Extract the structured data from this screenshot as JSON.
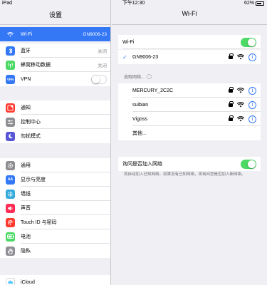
{
  "status_bar": {
    "device": "iPad",
    "time": "下午12:30",
    "battery": "62%"
  },
  "left": {
    "title": "设置",
    "group1": [
      {
        "label": "Wi-Fi",
        "value": "GN9006-23",
        "icon": "wifi-icon",
        "color": "#3478f6",
        "selected": true
      },
      {
        "label": "蓝牙",
        "value": "关闭",
        "icon": "bluetooth-icon",
        "color": "#3478f6"
      },
      {
        "label": "蜂窝移动数据",
        "value": "关闭",
        "icon": "antenna-icon",
        "color": "#4cd964"
      },
      {
        "label": "VPN",
        "icon": "vpn-icon",
        "icon_text": "VPN",
        "color": "#3478f6",
        "toggle": "off"
      }
    ],
    "group2": [
      {
        "label": "通知",
        "icon": "notification-icon",
        "color": "#ff3b30"
      },
      {
        "label": "控制中心",
        "icon": "control-center-icon",
        "color": "#8e8e93"
      },
      {
        "label": "勿扰模式",
        "icon": "moon-icon",
        "color": "#5856d6"
      }
    ],
    "group3": [
      {
        "label": "通用",
        "icon": "gear-icon",
        "color": "#8e8e93"
      },
      {
        "label": "显示与亮度",
        "icon": "display-icon",
        "icon_text": "AA",
        "color": "#3478f6"
      },
      {
        "label": "墙纸",
        "icon": "wallpaper-icon",
        "color": "#34aadc"
      },
      {
        "label": "声音",
        "icon": "speaker-icon",
        "color": "#ff2d55"
      },
      {
        "label": "Touch ID 与密码",
        "icon": "fingerprint-icon",
        "color": "#ff3b30"
      },
      {
        "label": "电池",
        "icon": "battery-icon",
        "color": "#4cd964"
      },
      {
        "label": "隐私",
        "icon": "hand-icon",
        "color": "#8e8e93"
      }
    ],
    "group4": [
      {
        "label": "iCloud",
        "icon": "cloud-icon",
        "color": "#ffffff"
      }
    ]
  },
  "right": {
    "title": "Wi-Fi",
    "wifi_label": "Wi-Fi",
    "wifi_toggle": "on",
    "connected_network": "GN9006-23",
    "choose_network_label": "选取网络...",
    "networks": [
      {
        "name": "MERCURY_2C2C"
      },
      {
        "name": "suibian"
      },
      {
        "name": "Vigoss"
      }
    ],
    "other_label": "其他...",
    "ask_to_join_label": "询问是否加入网络",
    "ask_to_join_toggle": "on",
    "footnote": "将自动加入已知网络。如果没有已知网络，将询问您是否加入新网络。",
    "accent_color": "#3478f6",
    "toggle_on_color": "#4cd964"
  }
}
